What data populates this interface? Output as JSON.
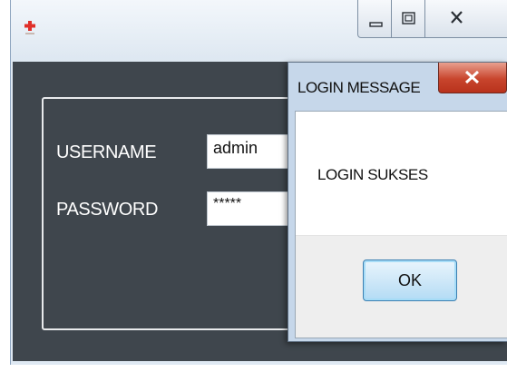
{
  "main_window": {
    "title_icon": "red-cross-icon",
    "controls": [
      "minimize-icon",
      "maximize-icon",
      "close-icon"
    ],
    "form": {
      "username_label": "USERNAME",
      "username_value": "admin",
      "password_label": "PASSWORD",
      "password_value": "*****"
    }
  },
  "dialog": {
    "title": "LOGIN MESSAGE",
    "message": "LOGIN SUKSES",
    "ok_label": "OK",
    "close_icon": "close-icon"
  },
  "colors": {
    "client_background": "#3f464d",
    "dialog_close_red": "#c8452d",
    "ok_button_blue": "#b3dbf5",
    "titlebar": "#dde7f1"
  }
}
